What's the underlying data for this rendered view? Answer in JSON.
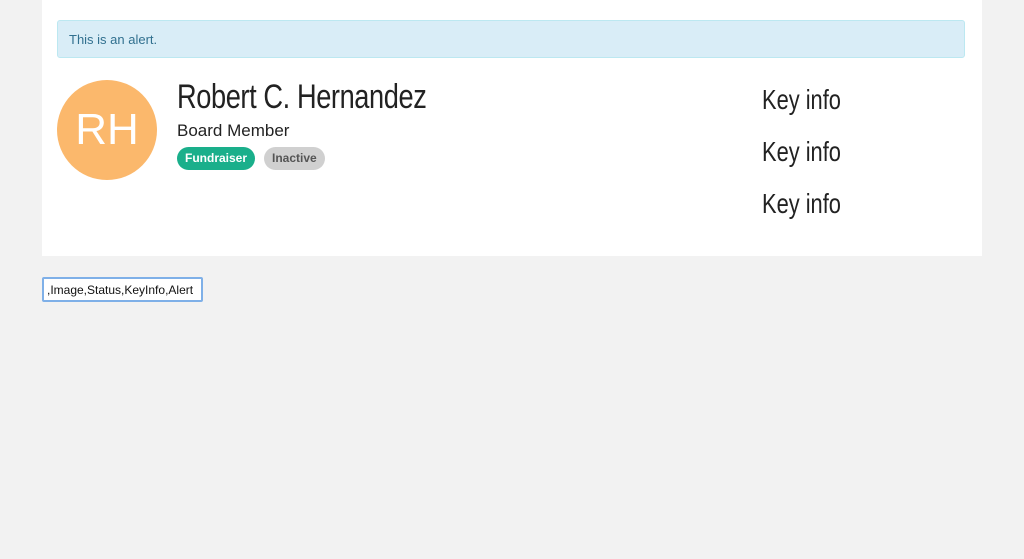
{
  "alert": {
    "text": "This is an alert."
  },
  "profile": {
    "initials": "RH",
    "avatar_color": "#fbb86c",
    "name": "Robert C. Hernandez",
    "role": "Board Member",
    "tags": [
      {
        "label": "Fundraiser",
        "color": "#1aaf8b"
      },
      {
        "label": "Inactive",
        "color": "#d0d0d0"
      }
    ]
  },
  "key_info": [
    "Key info",
    "Key info",
    "Key info"
  ],
  "classes_input": {
    "value": ",Image,Status,KeyInfo,Alert"
  }
}
